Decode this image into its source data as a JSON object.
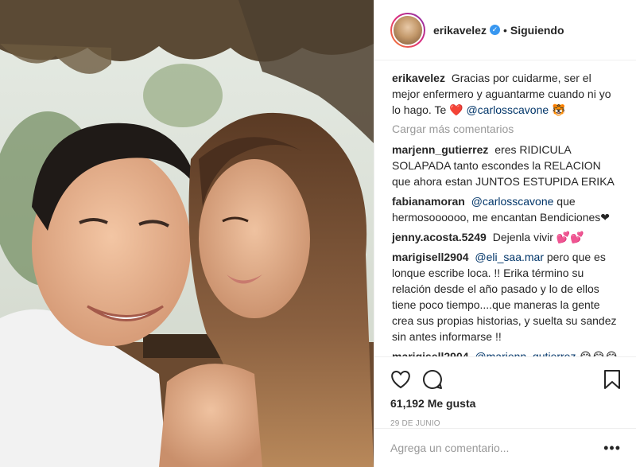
{
  "post": {
    "username": "erikavelez",
    "verified_icon": "verified-badge-icon",
    "separator": "•",
    "follow_status": "Siguiendo",
    "caption": {
      "user": "erikavelez",
      "text_1": "Gracias por cuidarme, ser el mejor enfermero y aguantarme cuando ni yo lo hago. Te",
      "heart": "❤️",
      "mention": "@carlosscavone",
      "emoji": "🐯"
    },
    "load_more": "Cargar más comentarios",
    "comments": [
      {
        "user": "marjenn_gutierrez",
        "pre": "",
        "mention": "",
        "text": "eres RIDICULA SOLAPADA tanto escondes la RELACION que ahora estan JUNTOS ESTUPIDA ERIKA"
      },
      {
        "user": "fabianamoran",
        "pre": "",
        "mention": "@carlosscavone",
        "text": "que hermosoooooo, me encantan Bendiciones❤"
      },
      {
        "user": "jenny.acosta.5249",
        "pre": "",
        "mention": "",
        "text": "Dejenla vivir 💕💕"
      },
      {
        "user": "marigisell2904",
        "pre": "",
        "mention": "@eli_saa.mar",
        "text": "pero que es lonque escribe loca. !! Erika término su relación desde el año pasado y lo de ellos tiene poco tiempo....que maneras la gente crea sus propias historias, y suelta su sandez sin antes informarse !!"
      },
      {
        "user": "marigisell2904",
        "pre": "",
        "mention": "@marjenn_gutierrez",
        "text": "😂😂😂😂😂es en serio lo que escribió?"
      }
    ],
    "likes": "61,192 Me gusta",
    "date": "29 DE JUNIO",
    "add_comment_placeholder": "Agrega un comentario...",
    "more_options": "•••"
  },
  "icons": {
    "like": "heart-icon",
    "comment": "comment-icon",
    "save": "bookmark-icon"
  }
}
